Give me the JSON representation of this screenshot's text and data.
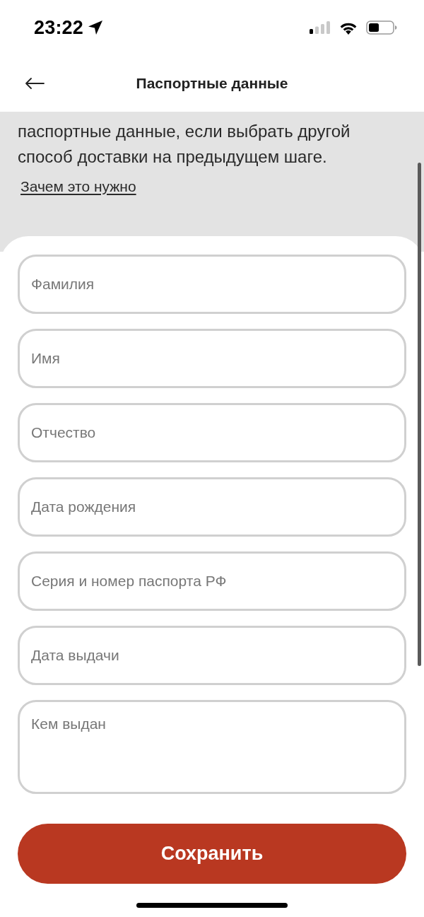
{
  "status_bar": {
    "time": "23:22"
  },
  "header": {
    "title": "Паспортные данные"
  },
  "notice": {
    "text": "паспортные данные, если выбрать другой способ доставки на предыдущем шаге.",
    "link": "Зачем это нужно"
  },
  "fields": [
    {
      "kind": "input",
      "placeholder": "Фамилия"
    },
    {
      "kind": "input",
      "placeholder": "Имя"
    },
    {
      "kind": "input",
      "placeholder": "Отчество"
    },
    {
      "kind": "input",
      "placeholder": "Дата рождения"
    },
    {
      "kind": "input",
      "placeholder": "Серия и номер паспорта РФ"
    },
    {
      "kind": "input",
      "placeholder": "Дата выдачи"
    },
    {
      "kind": "textarea",
      "placeholder": "Кем выдан"
    }
  ],
  "save_button": {
    "label": "Сохранить"
  }
}
